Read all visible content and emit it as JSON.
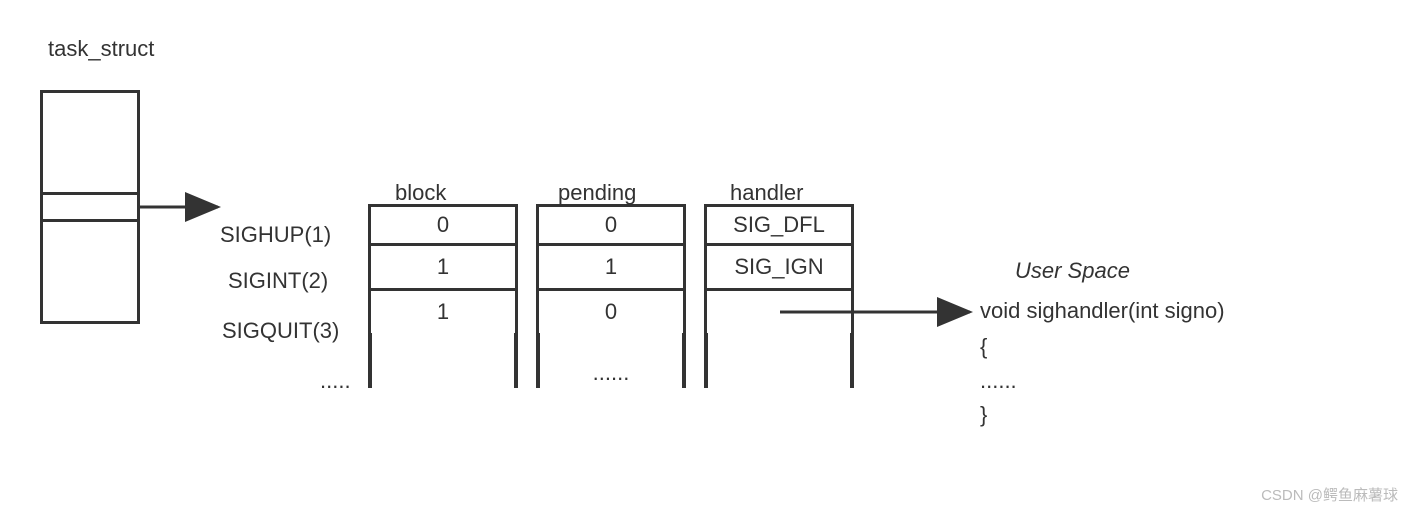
{
  "title": "task_struct",
  "columns": {
    "block": "block",
    "pending": "pending",
    "handler": "handler"
  },
  "signals": {
    "sighup": "SIGHUP(1)",
    "sigint": "SIGINT(2)",
    "sigquit": "SIGQUIT(3)",
    "ellipsis": "....."
  },
  "block_vals": {
    "r1": "0",
    "r2": "1",
    "r3": "1"
  },
  "pending_vals": {
    "r1": "0",
    "r2": "1",
    "r3": "0",
    "ellipsis": "......"
  },
  "handler_vals": {
    "r1": "SIG_DFL",
    "r2": "SIG_IGN"
  },
  "userspace": {
    "title": "User Space",
    "line1": "void sighandler(int signo)",
    "line2": "{",
    "line3": "......",
    "line4": "}"
  },
  "watermark": "CSDN @鳄鱼麻薯球"
}
